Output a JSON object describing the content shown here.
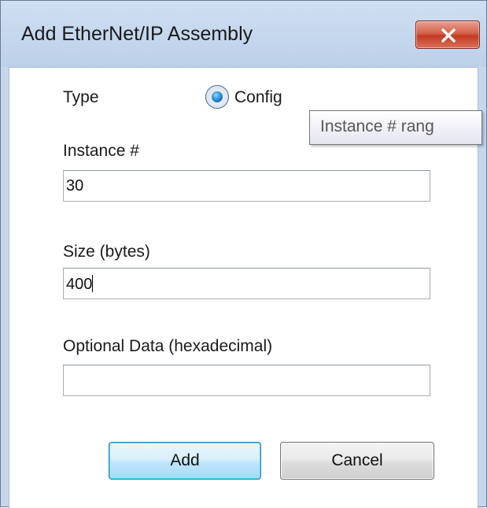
{
  "window": {
    "title": "Add EtherNet/IP Assembly"
  },
  "type_row": {
    "label": "Type",
    "radio_label": "Config",
    "radio_selected": true
  },
  "instance": {
    "label": "Instance #",
    "value": "30"
  },
  "tooltip": {
    "text": "Instance # rang"
  },
  "size": {
    "label": "Size (bytes)",
    "value": "400"
  },
  "optional_data": {
    "label": "Optional Data (hexadecimal)",
    "value": ""
  },
  "buttons": {
    "add_label": "Add",
    "cancel_label": "Cancel"
  },
  "icons": {
    "close": "close-icon"
  },
  "colors": {
    "close_button": "#c43b22",
    "default_button_border": "#3c7fb1",
    "radio_dot": "#2a8fd8"
  }
}
